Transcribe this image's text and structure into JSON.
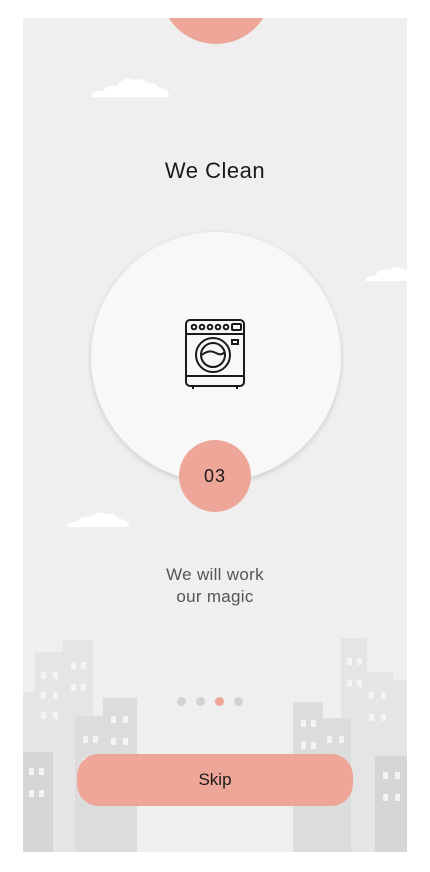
{
  "screen": {
    "title": "We Clean",
    "step_number": "03",
    "description_line1": "We will work",
    "description_line2": "our magic",
    "icon": "washing-machine-icon"
  },
  "pagination": {
    "total": 4,
    "active_index": 2
  },
  "actions": {
    "skip_label": "Skip"
  },
  "colors": {
    "accent": "#eda697",
    "background": "#efefef",
    "card": "#f8f8f8",
    "text": "#1a1a1a",
    "muted_text": "#555555"
  }
}
